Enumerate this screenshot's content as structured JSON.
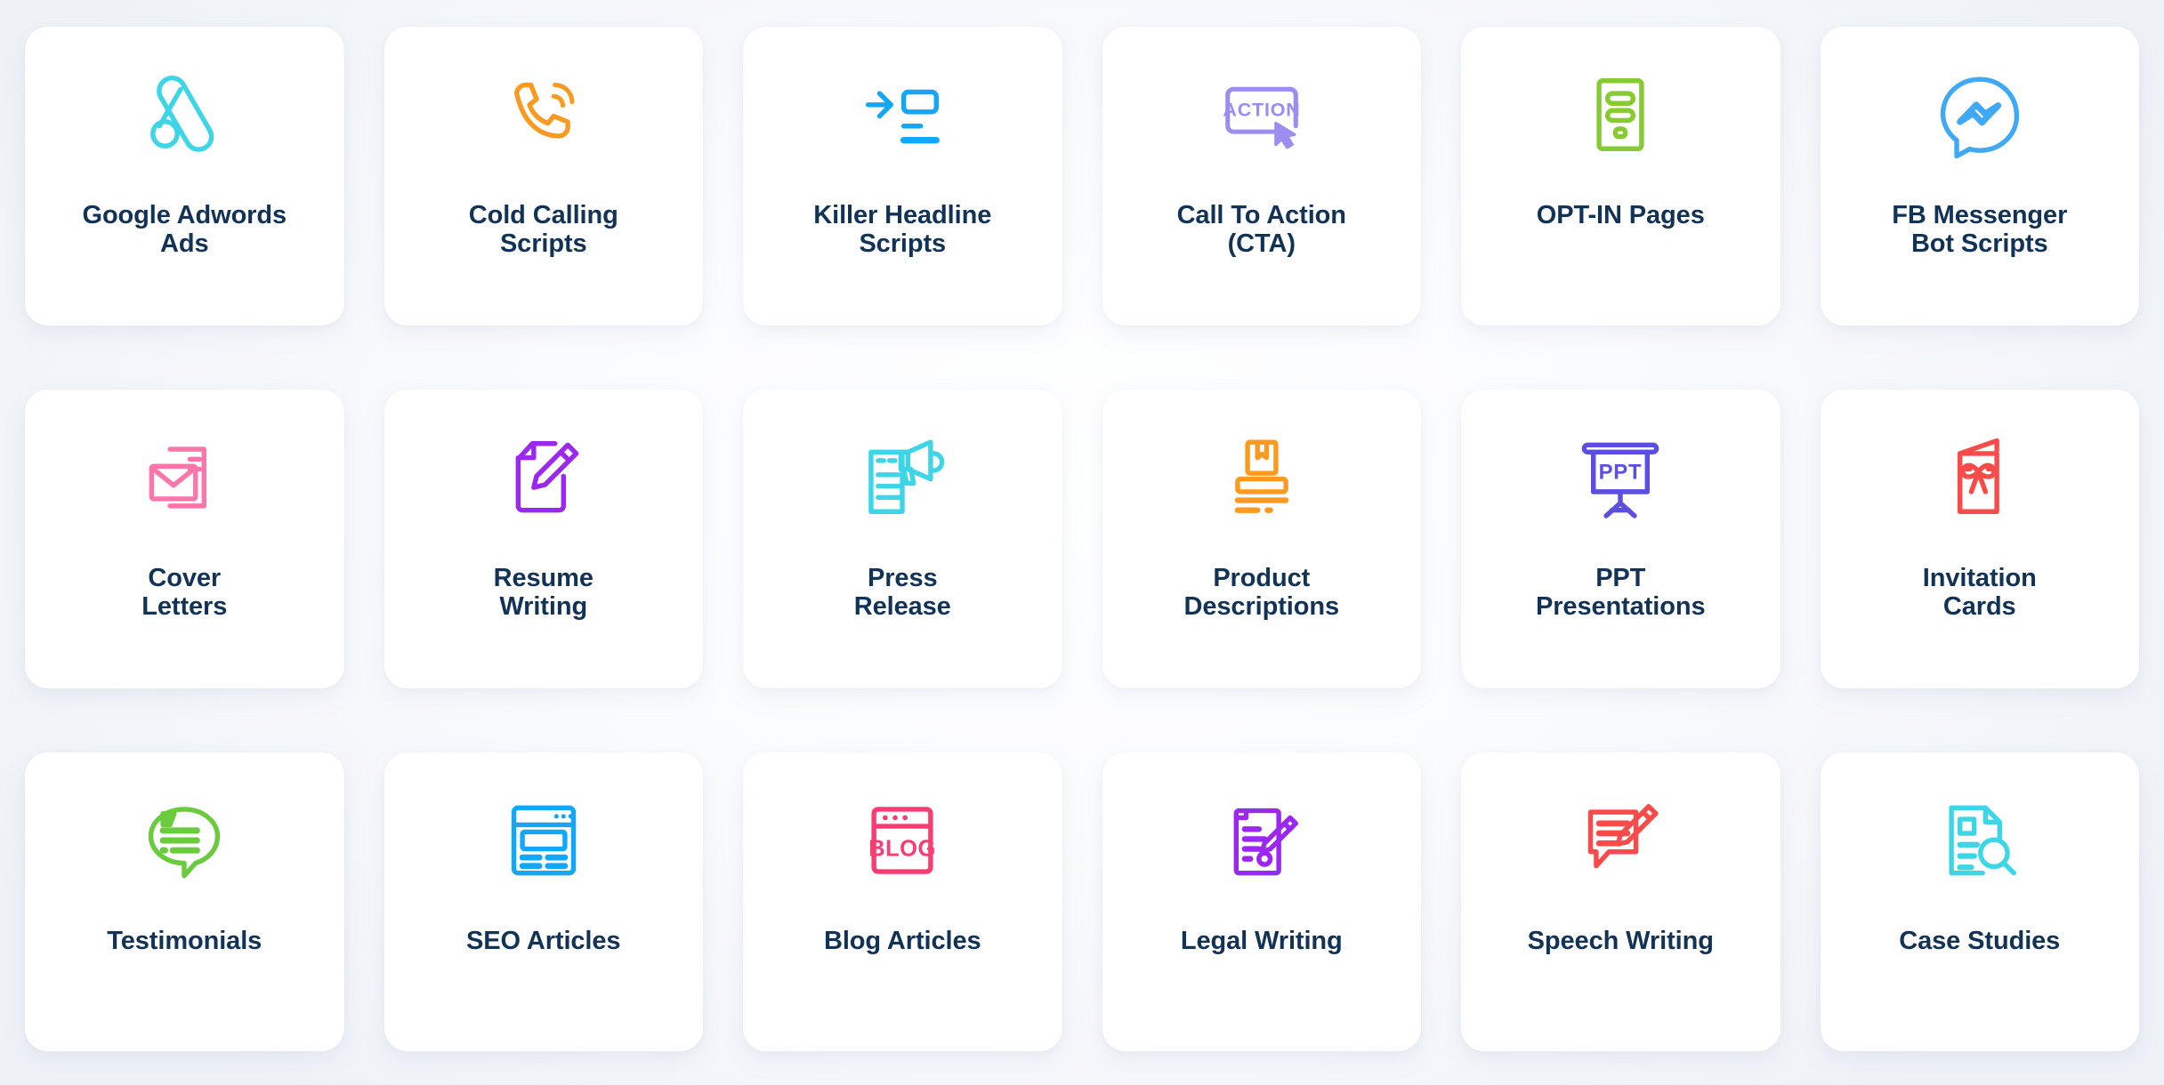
{
  "theme": {
    "page_background": "#f1f4f9",
    "card_background": "#ffffff",
    "label_color": "#123256"
  },
  "grid": {
    "columns": 6,
    "rows": 3,
    "total_cards": 18
  },
  "cards": [
    {
      "label": "Google Adwords\nAds",
      "icon": "google-adwords-icon",
      "color": "#3ed6e6"
    },
    {
      "label": "Cold Calling\nScripts",
      "icon": "phone-ringing-icon",
      "color": "#fb9a21"
    },
    {
      "label": "Killer Headline\nScripts",
      "icon": "headline-arrow-icon",
      "color": "#12a7fa"
    },
    {
      "label": "Call To Action\n(CTA)",
      "icon": "call-to-action-icon",
      "color": "#9b8ef0",
      "inner_text": "ACTION"
    },
    {
      "label": "OPT-IN Pages",
      "icon": "optin-page-icon",
      "color": "#86cb31"
    },
    {
      "label": "FB Messenger\nBot Scripts",
      "icon": "fb-messenger-icon",
      "color": "#3fa9f5"
    },
    {
      "label": "Cover\nLetters",
      "icon": "envelope-letter-icon",
      "color": "#fb77ab"
    },
    {
      "label": "Resume\nWriting",
      "icon": "document-pen-icon",
      "color": "#9b27f0"
    },
    {
      "label": "Press\nRelease",
      "icon": "megaphone-document-icon",
      "color": "#3ed6e6"
    },
    {
      "label": "Product\nDescriptions",
      "icon": "product-bookmark-icon",
      "color": "#fb9a21"
    },
    {
      "label": "PPT\nPresentations",
      "icon": "ppt-board-icon",
      "color": "#5b4fe0",
      "inner_text": "PPT"
    },
    {
      "label": "Invitation\nCards",
      "icon": "invitation-card-icon",
      "color": "#fb4a4a"
    },
    {
      "label": "Testimonials",
      "icon": "quote-bubble-icon",
      "color": "#6bcb3f"
    },
    {
      "label": "SEO Articles",
      "icon": "browser-layout-icon",
      "color": "#12a7fa"
    },
    {
      "label": "Blog Articles",
      "icon": "blog-window-icon",
      "color": "#fb3c72",
      "inner_text": "BLOG"
    },
    {
      "label": "Legal Writing",
      "icon": "legal-document-pen-icon",
      "color": "#9b27f0"
    },
    {
      "label": "Speech Writing",
      "icon": "speech-edit-icon",
      "color": "#fb4a4a"
    },
    {
      "label": "Case Studies",
      "icon": "case-study-search-icon",
      "color": "#3ed6e6"
    }
  ]
}
